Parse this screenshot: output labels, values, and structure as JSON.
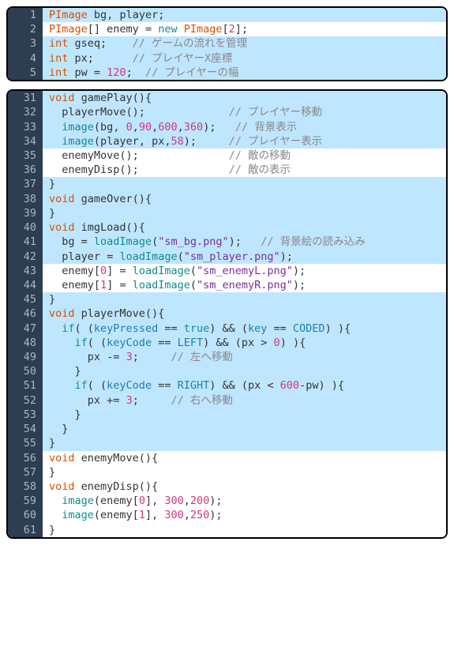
{
  "block1": {
    "lines": [
      {
        "n": 1,
        "hl": true,
        "tokens": [
          [
            "tk-type",
            "PImage"
          ],
          [
            "tk-id",
            " bg"
          ],
          [
            "tk-punct",
            ", "
          ],
          [
            "tk-id",
            "player"
          ],
          [
            "tk-punct",
            ";"
          ]
        ]
      },
      {
        "n": 2,
        "hl": false,
        "tokens": [
          [
            "tk-type",
            "PImage"
          ],
          [
            "tk-punct",
            "[] "
          ],
          [
            "tk-id",
            "enemy "
          ],
          [
            "tk-punct",
            "= "
          ],
          [
            "tk-kw",
            "new "
          ],
          [
            "tk-type",
            "PImage"
          ],
          [
            "tk-punct",
            "["
          ],
          [
            "tk-num",
            "2"
          ],
          [
            "tk-punct",
            "];"
          ]
        ]
      },
      {
        "n": 3,
        "hl": true,
        "tokens": [
          [
            "tk-type",
            "int"
          ],
          [
            "tk-id",
            " gseq"
          ],
          [
            "tk-punct",
            ";    "
          ],
          [
            "tk-cmt",
            "// ゲームの流れを管理"
          ]
        ]
      },
      {
        "n": 4,
        "hl": true,
        "tokens": [
          [
            "tk-type",
            "int"
          ],
          [
            "tk-id",
            " px"
          ],
          [
            "tk-punct",
            ";      "
          ],
          [
            "tk-cmt",
            "// プレイヤーX座標"
          ]
        ]
      },
      {
        "n": 5,
        "hl": true,
        "tokens": [
          [
            "tk-type",
            "int"
          ],
          [
            "tk-id",
            " pw "
          ],
          [
            "tk-punct",
            "= "
          ],
          [
            "tk-num",
            "120"
          ],
          [
            "tk-punct",
            ";  "
          ],
          [
            "tk-cmt",
            "// プレイヤーの幅"
          ]
        ]
      }
    ]
  },
  "block2": {
    "lines": [
      {
        "n": 31,
        "hl": true,
        "tokens": [
          [
            "tk-type",
            "void"
          ],
          [
            "tk-id",
            " gamePlay"
          ],
          [
            "tk-punct",
            "(){"
          ]
        ]
      },
      {
        "n": 32,
        "hl": true,
        "tokens": [
          [
            "tk-punct",
            "  "
          ],
          [
            "tk-id",
            "playerMove"
          ],
          [
            "tk-punct",
            "();             "
          ],
          [
            "tk-cmt",
            "// プレイヤー移動"
          ]
        ]
      },
      {
        "n": 33,
        "hl": true,
        "tokens": [
          [
            "tk-punct",
            "  "
          ],
          [
            "tk-fn",
            "image"
          ],
          [
            "tk-punct",
            "("
          ],
          [
            "tk-id",
            "bg"
          ],
          [
            "tk-punct",
            ", "
          ],
          [
            "tk-num",
            "0"
          ],
          [
            "tk-punct",
            ","
          ],
          [
            "tk-num",
            "90"
          ],
          [
            "tk-punct",
            ","
          ],
          [
            "tk-num",
            "600"
          ],
          [
            "tk-punct",
            ","
          ],
          [
            "tk-num",
            "360"
          ],
          [
            "tk-punct",
            ");   "
          ],
          [
            "tk-cmt",
            "// 背景表示"
          ]
        ]
      },
      {
        "n": 34,
        "hl": true,
        "tokens": [
          [
            "tk-punct",
            "  "
          ],
          [
            "tk-fn",
            "image"
          ],
          [
            "tk-punct",
            "("
          ],
          [
            "tk-id",
            "player"
          ],
          [
            "tk-punct",
            ", "
          ],
          [
            "tk-id",
            "px"
          ],
          [
            "tk-punct",
            ","
          ],
          [
            "tk-num",
            "58"
          ],
          [
            "tk-punct",
            ");     "
          ],
          [
            "tk-cmt",
            "// プレイヤー表示"
          ]
        ]
      },
      {
        "n": 35,
        "hl": false,
        "tokens": [
          [
            "tk-punct",
            "  "
          ],
          [
            "tk-id",
            "enemyMove"
          ],
          [
            "tk-punct",
            "();              "
          ],
          [
            "tk-cmt",
            "// 敵の移動"
          ]
        ]
      },
      {
        "n": 36,
        "hl": false,
        "tokens": [
          [
            "tk-punct",
            "  "
          ],
          [
            "tk-id",
            "enemyDisp"
          ],
          [
            "tk-punct",
            "();              "
          ],
          [
            "tk-cmt",
            "// 敵の表示"
          ]
        ]
      },
      {
        "n": 37,
        "hl": true,
        "tokens": [
          [
            "tk-punct",
            "}"
          ]
        ]
      },
      {
        "n": 38,
        "hl": true,
        "tokens": [
          [
            "tk-type",
            "void"
          ],
          [
            "tk-id",
            " gameOver"
          ],
          [
            "tk-punct",
            "(){"
          ]
        ]
      },
      {
        "n": 39,
        "hl": true,
        "tokens": [
          [
            "tk-punct",
            "}"
          ]
        ]
      },
      {
        "n": 40,
        "hl": true,
        "tokens": [
          [
            "tk-type",
            "void"
          ],
          [
            "tk-id",
            " imgLoad"
          ],
          [
            "tk-punct",
            "(){"
          ]
        ]
      },
      {
        "n": 41,
        "hl": true,
        "tokens": [
          [
            "tk-punct",
            "  "
          ],
          [
            "tk-id",
            "bg "
          ],
          [
            "tk-punct",
            "= "
          ],
          [
            "tk-fn",
            "loadImage"
          ],
          [
            "tk-punct",
            "("
          ],
          [
            "tk-str",
            "\"sm_bg.png\""
          ],
          [
            "tk-punct",
            ");   "
          ],
          [
            "tk-cmt",
            "// 背景絵の読み込み"
          ]
        ]
      },
      {
        "n": 42,
        "hl": true,
        "tokens": [
          [
            "tk-punct",
            "  "
          ],
          [
            "tk-id",
            "player "
          ],
          [
            "tk-punct",
            "= "
          ],
          [
            "tk-fn",
            "loadImage"
          ],
          [
            "tk-punct",
            "("
          ],
          [
            "tk-str",
            "\"sm_player.png\""
          ],
          [
            "tk-punct",
            ");"
          ]
        ]
      },
      {
        "n": 43,
        "hl": false,
        "tokens": [
          [
            "tk-punct",
            "  "
          ],
          [
            "tk-id",
            "enemy"
          ],
          [
            "tk-punct",
            "["
          ],
          [
            "tk-num",
            "0"
          ],
          [
            "tk-punct",
            "] = "
          ],
          [
            "tk-fn",
            "loadImage"
          ],
          [
            "tk-punct",
            "("
          ],
          [
            "tk-str",
            "\"sm_enemyL.png\""
          ],
          [
            "tk-punct",
            ");"
          ]
        ]
      },
      {
        "n": 44,
        "hl": false,
        "tokens": [
          [
            "tk-punct",
            "  "
          ],
          [
            "tk-id",
            "enemy"
          ],
          [
            "tk-punct",
            "["
          ],
          [
            "tk-num",
            "1"
          ],
          [
            "tk-punct",
            "] = "
          ],
          [
            "tk-fn",
            "loadImage"
          ],
          [
            "tk-punct",
            "("
          ],
          [
            "tk-str",
            "\"sm_enemyR.png\""
          ],
          [
            "tk-punct",
            ");"
          ]
        ]
      },
      {
        "n": 45,
        "hl": true,
        "tokens": [
          [
            "tk-punct",
            "}"
          ]
        ]
      },
      {
        "n": 46,
        "hl": true,
        "tokens": [
          [
            "tk-type",
            "void"
          ],
          [
            "tk-id",
            " playerMove"
          ],
          [
            "tk-punct",
            "(){"
          ]
        ]
      },
      {
        "n": 47,
        "hl": true,
        "tokens": [
          [
            "tk-punct",
            "  "
          ],
          [
            "tk-kw",
            "if"
          ],
          [
            "tk-punct",
            "( ("
          ],
          [
            "tk-const",
            "keyPressed"
          ],
          [
            "tk-punct",
            " == "
          ],
          [
            "tk-kw",
            "true"
          ],
          [
            "tk-punct",
            ") && ("
          ],
          [
            "tk-const",
            "key"
          ],
          [
            "tk-punct",
            " == "
          ],
          [
            "tk-const",
            "CODED"
          ],
          [
            "tk-punct",
            ") ){"
          ]
        ]
      },
      {
        "n": 48,
        "hl": true,
        "tokens": [
          [
            "tk-punct",
            "    "
          ],
          [
            "tk-kw",
            "if"
          ],
          [
            "tk-punct",
            "( ("
          ],
          [
            "tk-const",
            "keyCode"
          ],
          [
            "tk-punct",
            " == "
          ],
          [
            "tk-const",
            "LEFT"
          ],
          [
            "tk-punct",
            ") && ("
          ],
          [
            "tk-id",
            "px"
          ],
          [
            "tk-punct",
            " > "
          ],
          [
            "tk-num",
            "0"
          ],
          [
            "tk-punct",
            ") ){"
          ]
        ]
      },
      {
        "n": 49,
        "hl": true,
        "tokens": [
          [
            "tk-punct",
            "      "
          ],
          [
            "tk-id",
            "px "
          ],
          [
            "tk-punct",
            "-= "
          ],
          [
            "tk-num",
            "3"
          ],
          [
            "tk-punct",
            ";     "
          ],
          [
            "tk-cmt",
            "// 左へ移動"
          ]
        ]
      },
      {
        "n": 50,
        "hl": true,
        "tokens": [
          [
            "tk-punct",
            "    }"
          ]
        ]
      },
      {
        "n": 51,
        "hl": true,
        "tokens": [
          [
            "tk-punct",
            "    "
          ],
          [
            "tk-kw",
            "if"
          ],
          [
            "tk-punct",
            "( ("
          ],
          [
            "tk-const",
            "keyCode"
          ],
          [
            "tk-punct",
            " == "
          ],
          [
            "tk-const",
            "RIGHT"
          ],
          [
            "tk-punct",
            ") && ("
          ],
          [
            "tk-id",
            "px"
          ],
          [
            "tk-punct",
            " < "
          ],
          [
            "tk-num",
            "600"
          ],
          [
            "tk-punct",
            "-"
          ],
          [
            "tk-id",
            "pw"
          ],
          [
            "tk-punct",
            ") ){"
          ]
        ]
      },
      {
        "n": 52,
        "hl": true,
        "tokens": [
          [
            "tk-punct",
            "      "
          ],
          [
            "tk-id",
            "px "
          ],
          [
            "tk-punct",
            "+= "
          ],
          [
            "tk-num",
            "3"
          ],
          [
            "tk-punct",
            ";     "
          ],
          [
            "tk-cmt",
            "// 右へ移動"
          ]
        ]
      },
      {
        "n": 53,
        "hl": true,
        "tokens": [
          [
            "tk-punct",
            "    }"
          ]
        ]
      },
      {
        "n": 54,
        "hl": true,
        "tokens": [
          [
            "tk-punct",
            "  }"
          ]
        ]
      },
      {
        "n": 55,
        "hl": true,
        "tokens": [
          [
            "tk-punct",
            "}"
          ]
        ]
      },
      {
        "n": 56,
        "hl": false,
        "tokens": [
          [
            "tk-type",
            "void"
          ],
          [
            "tk-id",
            " enemyMove"
          ],
          [
            "tk-punct",
            "(){"
          ]
        ]
      },
      {
        "n": 57,
        "hl": false,
        "tokens": [
          [
            "tk-punct",
            "}"
          ]
        ]
      },
      {
        "n": 58,
        "hl": false,
        "tokens": [
          [
            "tk-type",
            "void"
          ],
          [
            "tk-id",
            " enemyDisp"
          ],
          [
            "tk-punct",
            "(){"
          ]
        ]
      },
      {
        "n": 59,
        "hl": false,
        "tokens": [
          [
            "tk-punct",
            "  "
          ],
          [
            "tk-fn",
            "image"
          ],
          [
            "tk-punct",
            "("
          ],
          [
            "tk-id",
            "enemy"
          ],
          [
            "tk-punct",
            "["
          ],
          [
            "tk-num",
            "0"
          ],
          [
            "tk-punct",
            "], "
          ],
          [
            "tk-num",
            "300"
          ],
          [
            "tk-punct",
            ","
          ],
          [
            "tk-num",
            "200"
          ],
          [
            "tk-punct",
            ");"
          ]
        ]
      },
      {
        "n": 60,
        "hl": false,
        "tokens": [
          [
            "tk-punct",
            "  "
          ],
          [
            "tk-fn",
            "image"
          ],
          [
            "tk-punct",
            "("
          ],
          [
            "tk-id",
            "enemy"
          ],
          [
            "tk-punct",
            "["
          ],
          [
            "tk-num",
            "1"
          ],
          [
            "tk-punct",
            "], "
          ],
          [
            "tk-num",
            "300"
          ],
          [
            "tk-punct",
            ","
          ],
          [
            "tk-num",
            "250"
          ],
          [
            "tk-punct",
            ");"
          ]
        ]
      },
      {
        "n": 61,
        "hl": false,
        "tokens": [
          [
            "tk-punct",
            "}"
          ]
        ]
      }
    ]
  }
}
